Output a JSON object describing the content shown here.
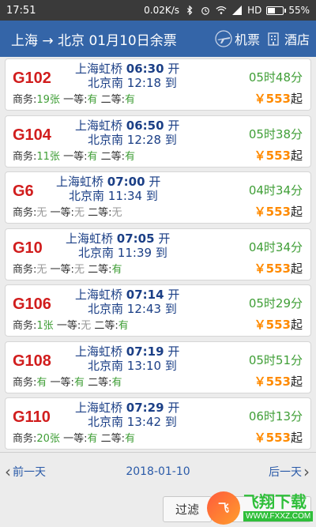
{
  "status_bar": {
    "time": "17:51",
    "network_speed": "0.02K/s",
    "network_type": "HD",
    "battery_percent": "55%",
    "battery_level": 0.55,
    "icons": [
      "bluetooth-icon",
      "alarm-icon",
      "wifi-icon",
      "signal-icon",
      "battery-icon"
    ]
  },
  "header": {
    "title": "上海 → 北京 01月10日余票",
    "flight_label": "机票",
    "hotel_label": "酒店",
    "icons": [
      "airplane-icon",
      "hotel-icon"
    ]
  },
  "trains": [
    {
      "code": "G102",
      "from": "上海虹桥",
      "dep_time": "06:30",
      "dep_suffix": "开",
      "to": "北京南",
      "arr_time": "12:18",
      "arr_suffix": "到",
      "duration": "05时48分",
      "business_label": "商务:",
      "business": "19张",
      "first_label": "一等:",
      "first": "有",
      "second_label": "二等:",
      "second": "有",
      "price": "553",
      "price_prefix": "￥",
      "price_suffix": "起"
    },
    {
      "code": "G104",
      "from": "上海虹桥",
      "dep_time": "06:50",
      "dep_suffix": "开",
      "to": "北京南",
      "arr_time": "12:28",
      "arr_suffix": "到",
      "duration": "05时38分",
      "business_label": "商务:",
      "business": "11张",
      "first_label": "一等:",
      "first": "有",
      "second_label": "二等:",
      "second": "有",
      "price": "553",
      "price_prefix": "￥",
      "price_suffix": "起"
    },
    {
      "code": "G6",
      "from": "上海虹桥",
      "dep_time": "07:00",
      "dep_suffix": "开",
      "to": "北京南",
      "arr_time": "11:34",
      "arr_suffix": "到",
      "duration": "04时34分",
      "business_label": "商务:",
      "business": "无",
      "first_label": "一等:",
      "first": "无",
      "second_label": "二等:",
      "second": "无",
      "price": "553",
      "price_prefix": "￥",
      "price_suffix": "起"
    },
    {
      "code": "G10",
      "from": "上海虹桥",
      "dep_time": "07:05",
      "dep_suffix": "开",
      "to": "北京南",
      "arr_time": "11:39",
      "arr_suffix": "到",
      "duration": "04时34分",
      "business_label": "商务:",
      "business": "无",
      "first_label": "一等:",
      "first": "无",
      "second_label": "二等:",
      "second": "有",
      "price": "553",
      "price_prefix": "￥",
      "price_suffix": "起"
    },
    {
      "code": "G106",
      "from": "上海虹桥",
      "dep_time": "07:14",
      "dep_suffix": "开",
      "to": "北京南",
      "arr_time": "12:43",
      "arr_suffix": "到",
      "duration": "05时29分",
      "business_label": "商务:",
      "business": "1张",
      "first_label": "一等:",
      "first": "无",
      "second_label": "二等:",
      "second": "有",
      "price": "553",
      "price_prefix": "￥",
      "price_suffix": "起"
    },
    {
      "code": "G108",
      "from": "上海虹桥",
      "dep_time": "07:19",
      "dep_suffix": "开",
      "to": "北京南",
      "arr_time": "13:10",
      "arr_suffix": "到",
      "duration": "05时51分",
      "business_label": "商务:",
      "business": "有",
      "first_label": "一等:",
      "first": "有",
      "second_label": "二等:",
      "second": "有",
      "price": "553",
      "price_prefix": "￥",
      "price_suffix": "起"
    },
    {
      "code": "G110",
      "from": "上海虹桥",
      "dep_time": "07:29",
      "dep_suffix": "开",
      "to": "北京南",
      "arr_time": "13:42",
      "arr_suffix": "到",
      "duration": "06时13分",
      "business_label": "商务:",
      "business": "20张",
      "first_label": "一等:",
      "first": "有",
      "second_label": "二等:",
      "second": "有",
      "price": "553",
      "price_prefix": "￥",
      "price_suffix": "起"
    }
  ],
  "date_nav": {
    "prev_label": "前一天",
    "date": "2018-01-10",
    "next_label": "后一天"
  },
  "bottom_bar": {
    "filter_label": "过滤"
  },
  "watermark": {
    "logo_text": "飞",
    "main_text": "飞翔下载",
    "sub_text": "WWW.FXXZ.COM"
  },
  "colors": {
    "header_bg": "#3465a8",
    "train_code": "#d11d1d",
    "available": "#3f9e36",
    "unavailable": "#999999",
    "price_yen": "#ff8a00",
    "link": "#2a5aa8"
  }
}
